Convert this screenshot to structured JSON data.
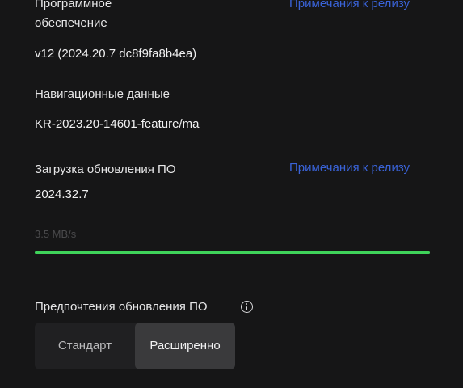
{
  "software": {
    "label_line1": "Программное",
    "label_line2": "обеспечение",
    "release_notes_link": "Примечания к релизу",
    "version": "v12 (2024.20.7 dc8f9fa8b4ea)"
  },
  "navigation": {
    "label": "Навигационные данные",
    "value": "KR-2023.20-14601-feature/ma"
  },
  "update": {
    "label": "Загрузка обновления ПО",
    "release_notes_link": "Примечания к релизу",
    "version": "2024.32.7",
    "speed": "3.5 MB/s",
    "progress_fraction": 1.0
  },
  "preferences": {
    "label": "Предпочтения обновления ПО",
    "info_icon": "info-icon",
    "options": [
      "Стандарт",
      "Расширенно"
    ],
    "selected": "Расширенно"
  },
  "colors": {
    "background": "#161617",
    "link": "#3a63d8",
    "progress": "#3fd35a"
  }
}
